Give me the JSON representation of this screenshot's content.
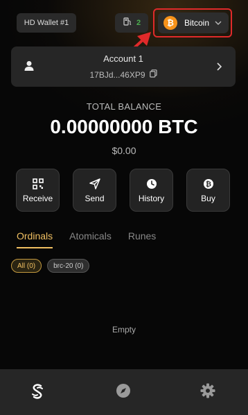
{
  "header": {
    "wallet_label": "HD Wallet #1",
    "gas_count": "2",
    "network_label": "Bitcoin",
    "network_icon": "bitcoin-logo",
    "highlight_color": "#e02a2a"
  },
  "account": {
    "name": "Account 1",
    "address": "17BJd...46XP9"
  },
  "balance": {
    "title": "TOTAL BALANCE",
    "amount": "0.00000000 BTC",
    "fiat": "$0.00"
  },
  "actions": [
    {
      "label": "Receive",
      "icon": "qr-code-icon"
    },
    {
      "label": "Send",
      "icon": "send-icon"
    },
    {
      "label": "History",
      "icon": "clock-icon"
    },
    {
      "label": "Buy",
      "icon": "bitcoin-coin-icon"
    }
  ],
  "tabs": [
    {
      "label": "Ordinals",
      "active": true
    },
    {
      "label": "Atomicals",
      "active": false
    },
    {
      "label": "Runes",
      "active": false
    }
  ],
  "filters": [
    {
      "label": "All (0)",
      "active": true
    },
    {
      "label": "brc-20 (0)",
      "active": false
    }
  ],
  "content": {
    "empty_text": "Empty"
  },
  "bottom_nav": [
    {
      "name": "wallet",
      "icon": "wallet-logo-icon"
    },
    {
      "name": "discover",
      "icon": "compass-icon"
    },
    {
      "name": "settings",
      "icon": "gear-icon"
    }
  ],
  "colors": {
    "accent": "#f1c062",
    "btc_orange": "#f7931a",
    "gas_green": "#4caf50"
  }
}
